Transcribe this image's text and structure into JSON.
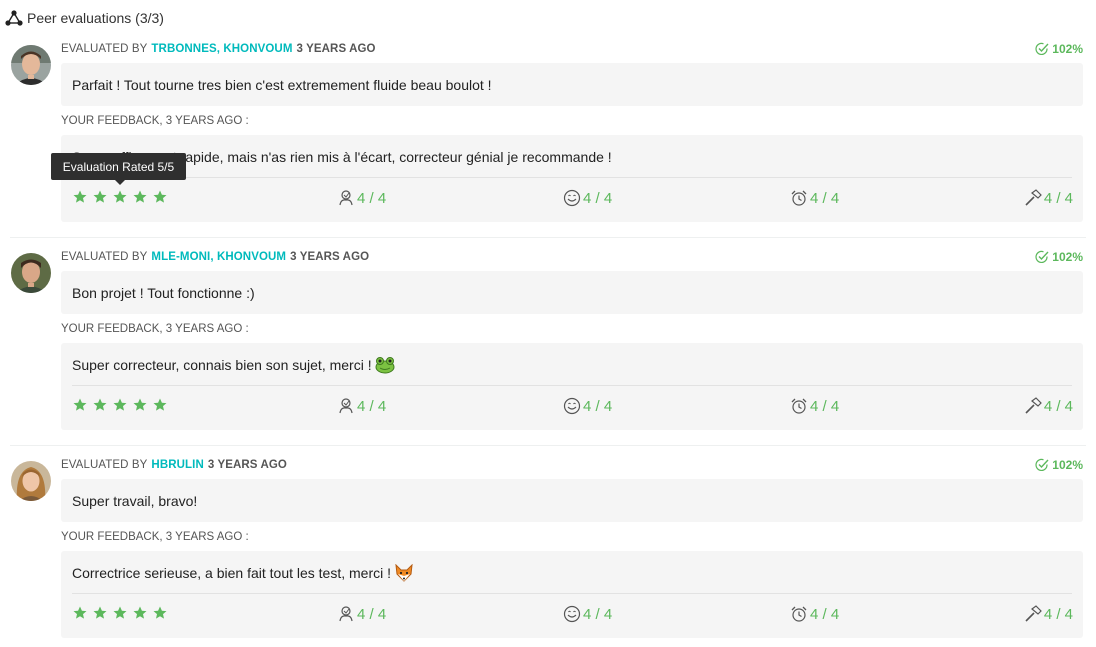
{
  "section": {
    "title": "Peer evaluations (3/3)",
    "icon": "network-icon"
  },
  "colors": {
    "accent": "#00babc",
    "success": "#5cb85c",
    "tooltip_bg": "#2f2f2f",
    "box_bg": "#f5f5f5"
  },
  "tooltip": {
    "text": "Evaluation Rated 5/5"
  },
  "evaluations": [
    {
      "evaluated_by_label": "EVALUATED BY",
      "evaluators": "TRBONNES, KHONVOUM",
      "when": "3 YEARS AGO",
      "score": "102%",
      "comment": "Parfait ! Tout tourne tres bien c'est extremement fluide beau boulot !",
      "feedback_label": "YOUR FEEDBACK, 3 YEARS AGO :",
      "feedback": "Super efficace et rapide, mais n'as rien mis à l'écart, correcteur génial je recommande !",
      "feedback_emoji": "",
      "stars": 5,
      "criteria": [
        {
          "icon": "nice-icon",
          "value": "4 / 4"
        },
        {
          "icon": "smile-icon",
          "value": "4 / 4"
        },
        {
          "icon": "alarm-clock-icon",
          "value": "4 / 4"
        },
        {
          "icon": "hammer-icon",
          "value": "4 / 4"
        }
      ]
    },
    {
      "evaluated_by_label": "EVALUATED BY",
      "evaluators": "MLE-MONI, KHONVOUM",
      "when": "3 YEARS AGO",
      "score": "102%",
      "comment": "Bon projet ! Tout fonctionne :)",
      "feedback_label": "YOUR FEEDBACK, 3 YEARS AGO :",
      "feedback": "Super correcteur, connais bien son sujet, merci !",
      "feedback_emoji": "frog-emoji",
      "stars": 5,
      "criteria": [
        {
          "icon": "nice-icon",
          "value": "4 / 4"
        },
        {
          "icon": "smile-icon",
          "value": "4 / 4"
        },
        {
          "icon": "alarm-clock-icon",
          "value": "4 / 4"
        },
        {
          "icon": "hammer-icon",
          "value": "4 / 4"
        }
      ]
    },
    {
      "evaluated_by_label": "EVALUATED BY",
      "evaluators": "HBRULIN",
      "when": "3 YEARS AGO",
      "score": "102%",
      "comment": "Super travail, bravo!",
      "feedback_label": "YOUR FEEDBACK, 3 YEARS AGO :",
      "feedback": "Correctrice serieuse, a bien fait tout les test, merci !",
      "feedback_emoji": "fox-emoji",
      "stars": 5,
      "criteria": [
        {
          "icon": "nice-icon",
          "value": "4 / 4"
        },
        {
          "icon": "smile-icon",
          "value": "4 / 4"
        },
        {
          "icon": "alarm-clock-icon",
          "value": "4 / 4"
        },
        {
          "icon": "hammer-icon",
          "value": "4 / 4"
        }
      ]
    }
  ]
}
